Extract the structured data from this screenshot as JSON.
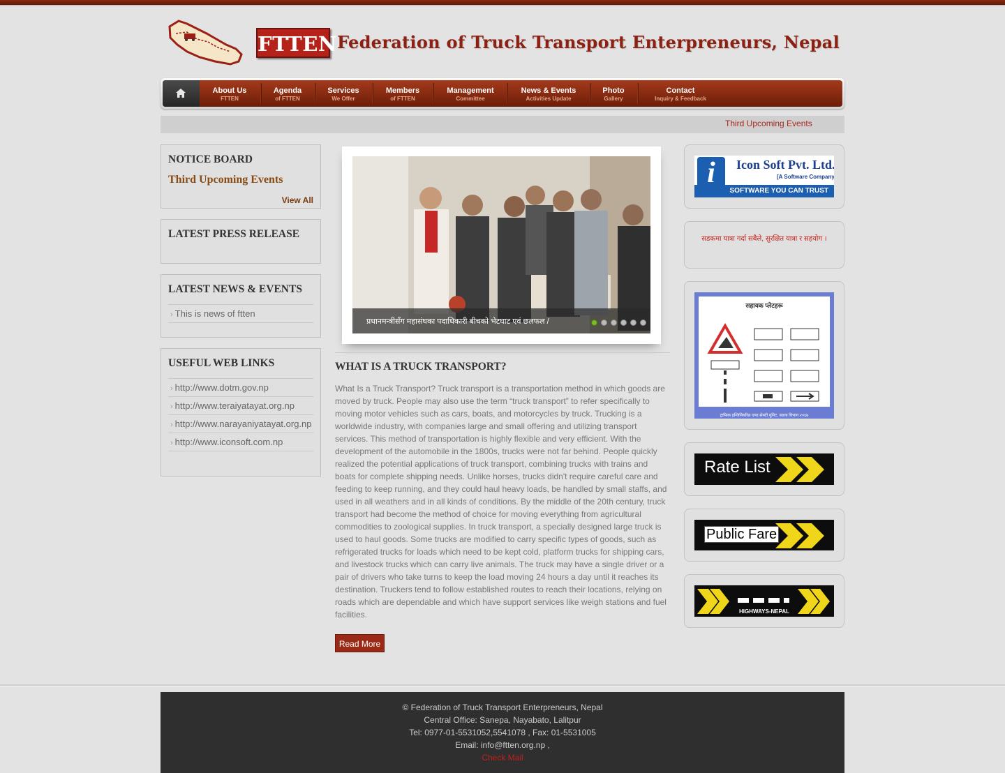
{
  "brand": {
    "short": "FTTEN",
    "title": "Federation of Truck Transport Enterpreneurs, Nepal"
  },
  "nav": {
    "home_icon": "home-icon",
    "items": [
      {
        "label": "About Us",
        "sub": "FTTEN"
      },
      {
        "label": "Agenda",
        "sub": "of FTTEN"
      },
      {
        "label": "Services",
        "sub": "We Offer"
      },
      {
        "label": "Members",
        "sub": "of FTTEN"
      },
      {
        "label": "Management",
        "sub": "Committee"
      },
      {
        "label": "News & Events",
        "sub": "Activities Update"
      },
      {
        "label": "Photo",
        "sub": "Gallery"
      },
      {
        "label": "Contact",
        "sub": "Inquiry & Feedback"
      }
    ]
  },
  "ticker": {
    "text": "Third Upcoming Events"
  },
  "notice_board": {
    "title": "NOTICE BOARD",
    "item": "Third Upcoming Events",
    "view_all": "View All"
  },
  "press_release": {
    "title": "LATEST PRESS RELEASE"
  },
  "news_events": {
    "title": "LATEST NEWS & EVENTS",
    "items": [
      "This is news of ftten"
    ]
  },
  "web_links": {
    "title": "USEFUL WEB LINKS",
    "items": [
      "http://www.dotm.gov.np",
      "http://www.teraiyatayat.org.np",
      "http://www.narayaniyatayat.org.np",
      "http://www.iconsoft.com.np"
    ]
  },
  "slider": {
    "caption": "प्रधानमन्त्रीसँग महासंघका पदाधिकारी बीचको भेटघाट एवं छलफल /",
    "total_slides": 6,
    "active_slide": 1
  },
  "article": {
    "title": "WHAT IS A TRUCK TRANSPORT?",
    "body": "What Is a Truck Transport? Truck transport is a transportation method in which goods are moved by truck. People may also use the term “truck transport” to refer specifically to moving motor vehicles such as cars, boats, and motorcycles by truck. Trucking is a worldwide industry, with companies large and small offering and utilizing transport services. This method of transportation is highly flexible and very efficient. With the development of the automobile in the 1800s, trucks were not far behind. People quickly realized the potential applications of truck transport, combining trucks with trains and boats for complete shipping needs. Unlike horses, trucks didn't require careful care and feeding to keep running, and they could haul heavy loads, be handled by small staffs, and used in all weathers and in all kinds of conditions. By the middle of the 20th century, truck transport had become the method of choice for moving everything from agricultural commodities to zoological supplies. In truck transport, a specially designed large truck is used to haul goods. Some trucks are modified to carry specific types of goods, such as refrigerated trucks for loads which need to be kept cold, platform trucks for shipping cars, and livestock trucks which can carry live animals. The truck may have a single driver or a pair of drivers who take turns to keep the load moving 24 hours a day until it reaches its destination. Truckers tend to follow established routes to reach their locations, relying on roads which are dependable and which have support services like weigh stations and fuel facilities.",
    "read_more": "Read More"
  },
  "sidebar_right": {
    "iconsoft": {
      "letter": "i",
      "name": "Icon Soft Pvt. Ltd.",
      "tag": "[A Software Company]",
      "slogan": "SOFTWARE YOU CAN TRUST"
    },
    "notice_text": "सडकमा यात्रा गर्दा सबैले, सुरक्षित यात्रा र सहयोग ।",
    "sign_board": {
      "title": "सहायक प्लेटहरू",
      "caption": "ट्राफिक इन्जिनियरिङ एण्ड सेफ्टी युनिट, सडक विभाग २०६७"
    },
    "rate_list": "Rate List",
    "public_fare": "Public Fare",
    "highways": "HIGHWAYS-NEPAL"
  },
  "footer": {
    "copyright": "© Federation of Truck Transport Enterpreneurs, Nepal",
    "office": "Central Office: Sanepa, Nayabato, Lalitpur",
    "tel": "Tel: 0977-01-5531052,5541078 , Fax: 01-5531005",
    "email": "Email: info@ftten.org.np ,",
    "check_mail": "Check Mail"
  },
  "colors": {
    "brand_red": "#b4221a",
    "nav_brown": "#8a2a12",
    "link_red": "#c0221a",
    "slider_dot_active": "#7cbb23"
  }
}
